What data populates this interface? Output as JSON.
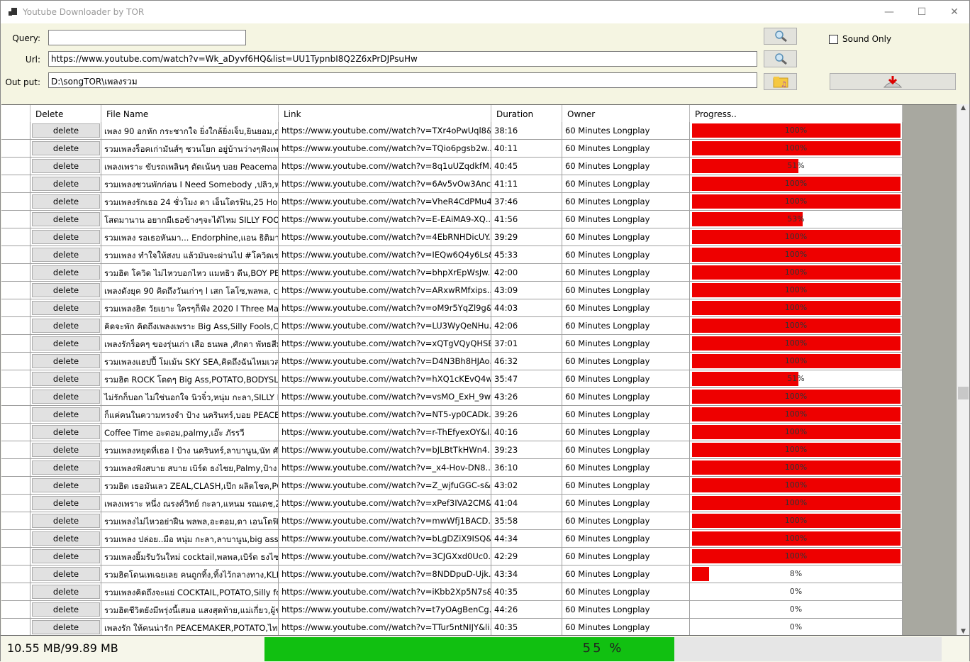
{
  "window": {
    "title": "Youtube Downloader by TOR",
    "minimize": "—",
    "maximize": "☐",
    "close": "✕"
  },
  "form": {
    "query_label": "Query:",
    "query_value": "",
    "url_label": "Url:",
    "url_value": "https://www.youtube.com/watch?v=Wk_aDyvf6HQ&list=UU1TypnbI8Q2Z6xPrDJPsuHw",
    "output_label": "Out put:",
    "output_value": "D:\\songTOR\\เพลงรวม",
    "sound_only_label": "Sound Only",
    "sound_only_checked": false
  },
  "table": {
    "headers": [
      "Delete",
      "File Name",
      "Link",
      "Duration",
      "Owner",
      "Progress.."
    ],
    "delete_label": "delete",
    "bar_color": "#ee0000",
    "rows": [
      [
        "เพลง 90 อกหัก กระชากใจ ยิ่งใกล้ยิ่งเจ็บ,ยินยอม,ถ่าน...",
        "https://www.youtube.com//watch?v=TXr4oPwUql8&...",
        "38:16",
        "60 Minutes Longplay",
        100
      ],
      [
        "รวมเพลงร็อคเก่ามันส์ๆ ชวนโยก อยู่บ้านว่างๆฟังเพลง ...",
        "https://www.youtube.com//watch?v=TQio6pgsb2w...",
        "40:11",
        "60 Minutes Longplay",
        100
      ],
      [
        "เพลงเพราะ ขับรถเพลินๆ ตัดเน้นๆ บอย Peacemake...",
        "https://www.youtube.com//watch?v=8q1uUZqdkfM...",
        "40:45",
        "60 Minutes Longplay",
        51
      ],
      [
        "รวมเพลงชวนพักก่อน I Need Somebody ,ปลิว,หะ...",
        "https://www.youtube.com//watch?v=6Av5vOw3Anc...",
        "41:11",
        "60 Minutes Longplay",
        100
      ],
      [
        "รวมเพลงรักเธอ 24 ชั่วโมง ดา เอ็นโดรฟิน,25 Hours,...",
        "https://www.youtube.com//watch?v=VheR4CdPMu4...",
        "37:46",
        "60 Minutes Longplay",
        100
      ],
      [
        "โสดมานาน อยากมีเธอข้างๆจะได้ไหม SILLY FOOLS...",
        "https://www.youtube.com//watch?v=E-EAiMA9-XQ...",
        "41:56",
        "60 Minutes Longplay",
        53
      ],
      [
        "รวมเพลง รอเธอหันมา... Endorphine,แอน ธิติมา,บ...",
        "https://www.youtube.com//watch?v=4EbRNHDicUY...",
        "39:29",
        "60 Minutes Longplay",
        100
      ],
      [
        "รวมเพลง ทำใจให้สงบ แล้วมันจะผ่านไป #โควิดเราต้อง...",
        "https://www.youtube.com//watch?v=IEQw6Q4y6Ls&...",
        "45:33",
        "60 Minutes Longplay",
        100
      ],
      [
        "รวมฮิต โควิด ไม่ไหวบอกไหว แมทธิว ดีน,BOY PEA...",
        "https://www.youtube.com//watch?v=bhpXrEpWsJw...",
        "42:00",
        "60 Minutes Longplay",
        100
      ],
      [
        "เพลงดังยุค 90 คิดถึงวันเก่าๆ l เสก โลโซ,พลพล, clas...",
        "https://www.youtube.com//watch?v=ARxwRMfxips...",
        "43:09",
        "60 Minutes Longplay",
        100
      ],
      [
        "รวมเพลงฮิต วัยเยาะ ใครๆก็ฟัง 2020 l Three Man D...",
        "https://www.youtube.com//watch?v=oM9r5YqZl9g&...",
        "44:03",
        "60 Minutes Longplay",
        100
      ],
      [
        "คิดจะพัก คิดถึงเพลงเพราะ Big Ass,Silly Fools,Cl...",
        "https://www.youtube.com//watch?v=LU3WyQeNHu...",
        "42:06",
        "60 Minutes Longplay",
        100
      ],
      [
        "เพลงรักร็อคๆ ของรุ่นเก่า เสือ ธนพล ,ศักดา พัทธสีมา,...",
        "https://www.youtube.com//watch?v=xQTgVQyQHSE...",
        "37:01",
        "60 Minutes Longplay",
        100
      ],
      [
        "รวมเพลงแฮปปี้ โมเม้น SKY SEA,คิดถึงฉันไหมเวลา...",
        "https://www.youtube.com//watch?v=D4N3Bh8HJAo...",
        "46:32",
        "60 Minutes Longplay",
        100
      ],
      [
        "รวมฮิต ROCK โดดๆ Big Ass,POTATO,BODYSLA...",
        "https://www.youtube.com//watch?v=hXQ1cKEvQ4w...",
        "35:47",
        "60 Minutes Longplay",
        51
      ],
      [
        "ไม่รักก็บอก ไม่ใช่นอกใจ นิวจิ๋ว,หนุ่ม กะลา,SILLY FO...",
        "https://www.youtube.com//watch?v=vsMO_ExH_9w...",
        "43:26",
        "60 Minutes Longplay",
        100
      ],
      [
        "ก็แค่คนในความทรงจำ ป้าง นครินทร์,บอย PEACEM...",
        "https://www.youtube.com//watch?v=NT5-yp0CADk...",
        "39:26",
        "60 Minutes Longplay",
        100
      ],
      [
        "Coffee Time อะตอม,palmy,เอ๊ะ ภัรรวี",
        "https://www.youtube.com//watch?v=r-ThEfyexOY&I...",
        "40:16",
        "60 Minutes Longplay",
        100
      ],
      [
        "รวมเพลงหยุดที่เธอ l ป้าง นครินทร์,ลาบานูน,นัท ศักด...",
        "https://www.youtube.com//watch?v=bJLBtTkHWn4...",
        "39:23",
        "60 Minutes Longplay",
        100
      ],
      [
        "รวมเพลงฟังสบาย สบาย เบิร์ด ธงไชย,Palmy,ป้าง น...",
        "https://www.youtube.com//watch?v=_x4-Hov-DN8...",
        "36:10",
        "60 Minutes Longplay",
        100
      ],
      [
        "รวมฮิต เธอมันเลว ZEAL,CLASH,เป๊ก ผลิตโชค,POT...",
        "https://www.youtube.com//watch?v=Z_wjfuGGC-s&...",
        "43:02",
        "60 Minutes Longplay",
        100
      ],
      [
        "เพลงเพราะ หนึ่ง ณรงค์วิทย์ กะลา,แหนม รณเดช,ZE...",
        "https://www.youtube.com//watch?v=xPef3IVA2CM&...",
        "41:04",
        "60 Minutes Longplay",
        100
      ],
      [
        "รวมเพลงไม่ไหวอย่าฝืน พลพล,อะตอม,ดา เอนโดฟิน, เ...",
        "https://www.youtube.com//watch?v=mwWfj1BACD...",
        "35:58",
        "60 Minutes Longplay",
        100
      ],
      [
        "รวมเพลง ปล่อย..มือ หนุ่ม กะลา,ลาบานูน,big ass,b...",
        "https://www.youtube.com//watch?v=bLgDZiX9ISQ&...",
        "44:34",
        "60 Minutes Longplay",
        100
      ],
      [
        "รวมเพลงยิ้มรับวันใหม่ cocktail,พลพล,เบิร์ด ธงไชย, ...",
        "https://www.youtube.com//watch?v=3CJGXxd0Uc0...",
        "42:29",
        "60 Minutes Longplay",
        100
      ],
      [
        "รวมฮิตโดนเทเฉยเลย คนถูกทิ้ง,ทิ้งไว้กลางทาง,KLEA...",
        "https://www.youtube.com//watch?v=8NDDpuD-Ujk...",
        "43:34",
        "60 Minutes Longplay",
        8
      ],
      [
        "รวมเพลงคิดถึงจะแย่ COCKTAIL,POTATO,Silly fo...",
        "https://www.youtube.com//watch?v=iKbb2Xp5N7s&...",
        "40:35",
        "60 Minutes Longplay",
        0
      ],
      [
        "รวมฮิตชีวิตยังมีพรุ่งนี้เสมอ แสงสุดท้าย,แม่เกี่ยว,ผู้ชนะ...",
        "https://www.youtube.com//watch?v=t7yOAgBenCg...",
        "44:26",
        "60 Minutes Longplay",
        0
      ],
      [
        "เพลงรัก ให้คนน่ารัก PEACEMAKER,POTATO,ไท ...",
        "https://www.youtube.com//watch?v=TTur5ntNIJY&li...",
        "40:35",
        "60 Minutes Longplay",
        0
      ]
    ]
  },
  "status": {
    "size": "10.55 MB/99.89 MB",
    "progress_percent": 55,
    "progress_text": "55 %",
    "progress_color": "#11c011"
  }
}
